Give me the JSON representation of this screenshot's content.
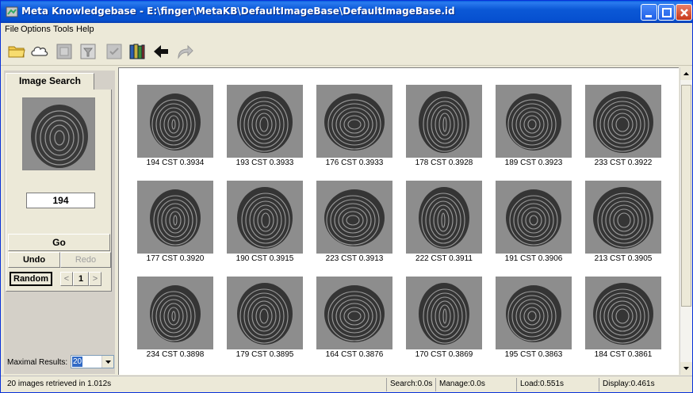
{
  "window": {
    "title": "Meta Knowledgebase - E:\\finger\\MetaKB\\DefaultImageBase\\DefaultImageBase.id"
  },
  "menu": [
    "File",
    "Options",
    "Tools",
    "Help"
  ],
  "toolbar": {
    "icons": [
      "open-folder-icon",
      "cloud-icon",
      "grid-icon",
      "filter-icon",
      "check-icon",
      "books-icon",
      "back-arrow-icon",
      "forward-arrow-icon"
    ]
  },
  "search": {
    "tab_label": "Image Search",
    "query_value": "194",
    "go_label": "Go",
    "undo_label": "Undo",
    "redo_label": "Redo",
    "random_label": "Random",
    "prev_label": "<",
    "page_value": "1",
    "next_label": ">",
    "maximal_results_label": "Maximal Results:",
    "maximal_results_value": "20"
  },
  "results": [
    {
      "caption": "194 CST 0.3934"
    },
    {
      "caption": "193 CST 0.3933"
    },
    {
      "caption": "176 CST 0.3933"
    },
    {
      "caption": "178 CST 0.3928"
    },
    {
      "caption": "189 CST 0.3923"
    },
    {
      "caption": "233 CST 0.3922"
    },
    {
      "caption": "177 CST 0.3920"
    },
    {
      "caption": "190 CST 0.3915"
    },
    {
      "caption": "223 CST 0.3913"
    },
    {
      "caption": "222 CST 0.3911"
    },
    {
      "caption": "191 CST 0.3906"
    },
    {
      "caption": "213 CST 0.3905"
    },
    {
      "caption": "234 CST 0.3898"
    },
    {
      "caption": "179 CST 0.3895"
    },
    {
      "caption": "164 CST 0.3876"
    },
    {
      "caption": "170 CST 0.3869"
    },
    {
      "caption": "195 CST 0.3863"
    },
    {
      "caption": "184 CST 0.3861"
    }
  ],
  "status": {
    "retrieved": "20 images retrieved in 1.012s",
    "search": "Search:0.0s",
    "manage": "Manage:0.0s",
    "load": "Load:0.551s",
    "display": "Display:0.461s"
  }
}
